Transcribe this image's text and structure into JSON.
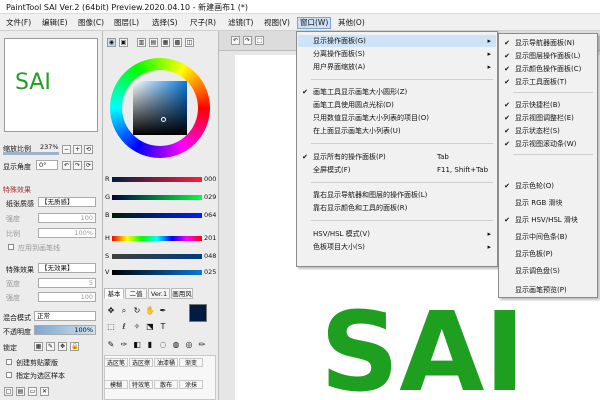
{
  "app": {
    "title": "PaintTool SAI Ver.2 (64bit) Preview.2020.04.10 - 新建画布1 (*)"
  },
  "menubar": [
    {
      "label": "文件(F)"
    },
    {
      "label": "编辑(E)"
    },
    {
      "label": "图像(C)"
    },
    {
      "label": "图层(L)"
    },
    {
      "label": "选择(S)"
    },
    {
      "label": "尺子(R)"
    },
    {
      "label": "滤镜(T)"
    },
    {
      "label": "视图(V)"
    },
    {
      "label": "窗口(W)"
    },
    {
      "label": "其他(O)"
    }
  ],
  "navigator": {
    "canvas_text": "SAI",
    "zoom_label": "缩放比例",
    "zoom_value": "237%",
    "angle_label": "显示角度",
    "angle_value": "0°"
  },
  "effects": {
    "section_label": "特殊效果",
    "paper_label": "纸张质感",
    "paper_value": "【无质感】",
    "strength_label": "强度",
    "strength_value": "100",
    "scale_label": "比例",
    "scale_value": "100%",
    "apply_label": "应用到画笔线",
    "effect_label": "特殊效果",
    "effect_value": "【无效果】",
    "width_label": "宽度",
    "width_value": "5",
    "strength2_label": "强度",
    "strength2_value": "100"
  },
  "layer": {
    "blend_label": "混合模式",
    "blend_value": "正常",
    "opacity_label": "不透明度",
    "opacity_value": "100%",
    "lock_label": "锁定",
    "clip_label": "创建剪贴蒙版",
    "sample_label": "指定为选区样本"
  },
  "color": {
    "r_label": "R",
    "r_value": "000",
    "g_label": "G",
    "g_value": "029",
    "b_label": "B",
    "b_value": "064",
    "h_label": "H",
    "h_value": "201",
    "s_label": "S",
    "s_value": "048",
    "v_label": "V",
    "v_value": "025",
    "current_color": "#001d40"
  },
  "tool_tabs": [
    {
      "label": "基本"
    },
    {
      "label": "二值"
    },
    {
      "label": "Ver.1"
    },
    {
      "label": "画用风"
    }
  ],
  "brush_names": [
    "选区笔",
    "选区擦",
    "油漆桶",
    "渐变",
    "模糊",
    "特效笔",
    "散布",
    "涂抹"
  ],
  "canvas": {
    "text": "SAI"
  },
  "window_menu": {
    "items": [
      {
        "check": "",
        "label": "显示操作面板(G)",
        "shortcut": "",
        "arrow": "▸",
        "highlight": true
      },
      {
        "check": "",
        "label": "分离操作面板(S)",
        "shortcut": "",
        "arrow": "▸"
      },
      {
        "check": "",
        "label": "用户界面缩放(A)",
        "shortcut": "",
        "arrow": "▸"
      },
      {
        "check": "✔",
        "label": "画笔工具显示画笔大小圆形(Z)",
        "shortcut": "",
        "arrow": ""
      },
      {
        "check": "",
        "label": "画笔工具使用圆点光标(D)",
        "shortcut": "",
        "arrow": ""
      },
      {
        "check": "",
        "label": "只用数值显示画笔大小列表的项目(O)",
        "shortcut": "",
        "arrow": ""
      },
      {
        "check": "",
        "label": "在上面显示画笔大小列表(U)",
        "shortcut": "",
        "arrow": ""
      },
      {
        "check": "✔",
        "label": "显示所有的操作面板(P)",
        "shortcut": "Tab",
        "arrow": ""
      },
      {
        "check": "",
        "label": "全屏模式(F)",
        "shortcut": "F11, Shift+Tab",
        "arrow": ""
      },
      {
        "check": "",
        "label": "靠右显示导航器和图层的操作面板(L)",
        "shortcut": "",
        "arrow": ""
      },
      {
        "check": "",
        "label": "靠右显示颜色和工具的面板(R)",
        "shortcut": "",
        "arrow": ""
      },
      {
        "check": "",
        "label": "HSV/HSL 模式(V)",
        "shortcut": "",
        "arrow": "▸"
      },
      {
        "check": "",
        "label": "色板项目大小(S)",
        "shortcut": "",
        "arrow": "▸"
      }
    ]
  },
  "submenu": {
    "items": [
      {
        "check": "✔",
        "label": "显示导航器面板(N)"
      },
      {
        "check": "✔",
        "label": "显示图层操作面板(L)"
      },
      {
        "check": "✔",
        "label": "显示颜色操作面板(C)"
      },
      {
        "check": "✔",
        "label": "显示工具面板(T)"
      },
      {
        "check": "✔",
        "label": "显示快捷栏(B)"
      },
      {
        "check": "✔",
        "label": "显示视图调整栏(E)"
      },
      {
        "check": "✔",
        "label": "显示状态栏(S)"
      },
      {
        "check": "✔",
        "label": "显示视图滚动条(W)"
      },
      {
        "check": "✔",
        "label": "显示色轮(O)"
      },
      {
        "check": "",
        "label": "显示 RGB 滑块"
      },
      {
        "check": "✔",
        "label": "显示 HSV/HSL 滑块"
      },
      {
        "check": "",
        "label": "显示中间色条(B)"
      },
      {
        "check": "",
        "label": "显示色板(P)"
      },
      {
        "check": "",
        "label": "显示调色盘(S)"
      },
      {
        "check": "",
        "label": "显示画笔预览(P)"
      }
    ]
  }
}
